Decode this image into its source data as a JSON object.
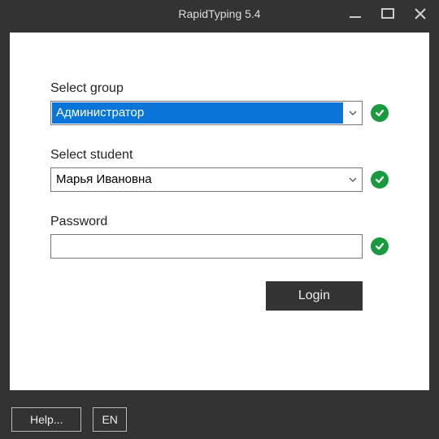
{
  "window": {
    "title": "RapidTyping 5.4"
  },
  "form": {
    "group": {
      "label": "Select group",
      "value": "Администратор",
      "highlighted": true
    },
    "student": {
      "label": "Select student",
      "value": "Марья Ивановна",
      "highlighted": false
    },
    "password": {
      "label": "Password",
      "value": ""
    },
    "login_label": "Login"
  },
  "footer": {
    "help_label": "Help...",
    "lang_label": "EN"
  },
  "icons": {
    "minimize": "minimize-icon",
    "maximize": "maximize-icon",
    "close": "close-icon",
    "chevron": "chevron-down-icon",
    "check": "check-icon"
  },
  "colors": {
    "window_bg": "#333333",
    "panel_bg": "#ffffff",
    "highlight": "#0a75d8",
    "check_ok": "#1a9a3f"
  }
}
